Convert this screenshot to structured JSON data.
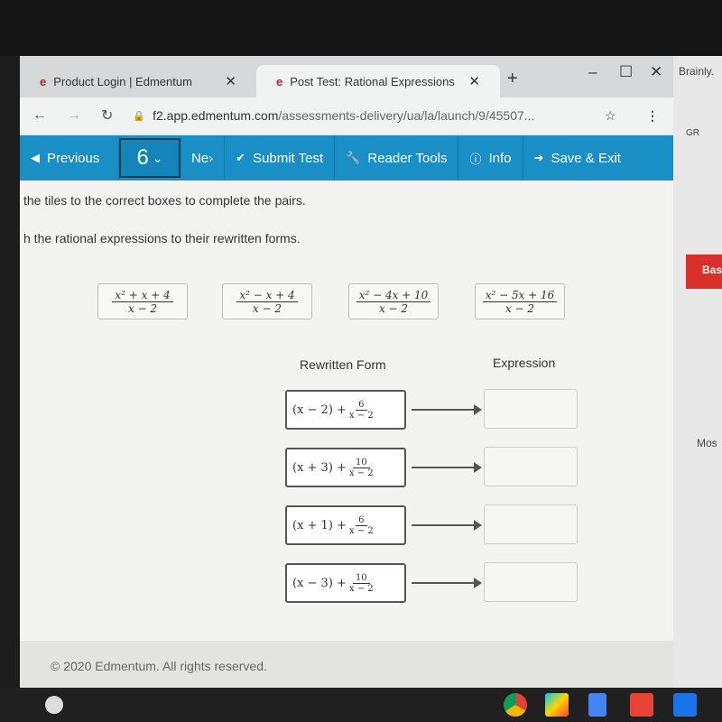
{
  "browser": {
    "tabs": [
      {
        "label": "Product Login | Edmentum",
        "active": false
      },
      {
        "label": "Post Test: Rational Expressions",
        "active": true
      }
    ],
    "url_host": "f2.app.edmentum.com",
    "url_path": "/assessments-delivery/ua/la/launch/9/45507..."
  },
  "toolbar": {
    "previous": "Previous",
    "question": "6",
    "next": "Ne›",
    "submit": "Submit Test",
    "reader_tools": "Reader Tools",
    "info": "Info",
    "save_exit": "Save & Exit",
    "color": "#1a8fc6"
  },
  "instructions": [
    "the tiles to the correct boxes to complete the pairs.",
    "h the rational expressions to their rewritten forms."
  ],
  "tiles": [
    {
      "num": "x² + x + 4",
      "den": "x − 2"
    },
    {
      "num": "x² − x + 4",
      "den": "x − 2"
    },
    {
      "num": "x² − 4x + 10",
      "den": "x − 2"
    },
    {
      "num": "x² − 5x + 16",
      "den": "x − 2"
    }
  ],
  "columns": {
    "rewritten": "Rewritten Form",
    "expression": "Expression"
  },
  "pairs": [
    {
      "lead": "(x − 2) +",
      "num": "6",
      "den": "x − 2"
    },
    {
      "lead": "(x + 3) +",
      "num": "10",
      "den": "x − 2"
    },
    {
      "lead": "(x + 1) +",
      "num": "6",
      "den": "x − 2"
    },
    {
      "lead": "(x − 3) +",
      "num": "10",
      "den": "x − 2"
    }
  ],
  "footer": "© 2020 Edmentum. All rights reserved.",
  "side_window": {
    "tab": "Brainly.",
    "gr": "GR",
    "button": "Bas",
    "text": "Mos"
  }
}
